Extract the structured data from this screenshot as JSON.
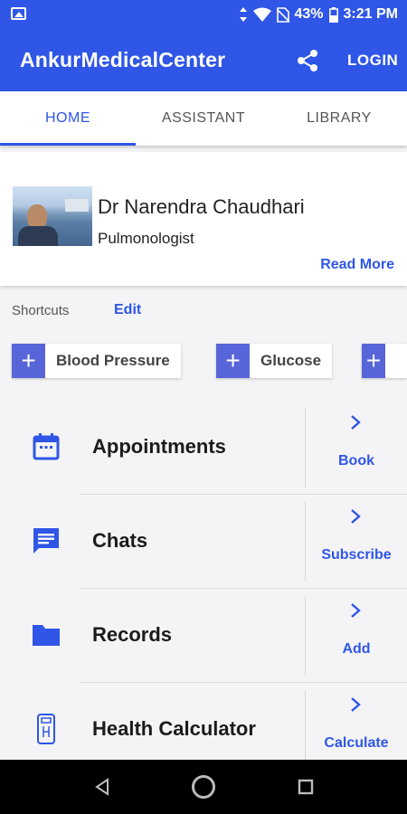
{
  "status_bar": {
    "battery": "43%",
    "time": "3:21 PM",
    "icons": [
      "gallery-icon",
      "vibrate-icon",
      "wifi-icon",
      "no-sim-icon",
      "battery-icon"
    ]
  },
  "app_bar": {
    "title": "AnkurMedicalCenter",
    "share_icon": "share-icon",
    "login_label": "LOGIN"
  },
  "tabs": [
    {
      "label": "HOME",
      "active": true
    },
    {
      "label": "ASSISTANT"
    },
    {
      "label": "LIBRARY"
    }
  ],
  "doctor": {
    "name": "Dr Narendra Chaudhari",
    "specialty": "Pulmonologist",
    "read_more": "Read More"
  },
  "shortcuts": {
    "label": "Shortcuts",
    "edit": "Edit",
    "items": [
      {
        "label": "Blood Pressure"
      },
      {
        "label": "Glucose"
      },
      {
        "label": ""
      }
    ]
  },
  "menu": [
    {
      "label": "Appointments",
      "action": "Book",
      "icon": "calendar-icon"
    },
    {
      "label": "Chats",
      "action": "Subscribe",
      "icon": "chat-icon"
    },
    {
      "label": "Records",
      "action": "Add",
      "icon": "folder-icon"
    },
    {
      "label": "Health Calculator",
      "action": "Calculate",
      "icon": "calculator-icon"
    }
  ],
  "nav_bar": {
    "icons": [
      "back-icon",
      "home-icon",
      "recents-icon"
    ]
  },
  "colors": {
    "primary": "#2f56e6",
    "chip_accent": "#5865d8",
    "background": "#f4f4f6"
  }
}
